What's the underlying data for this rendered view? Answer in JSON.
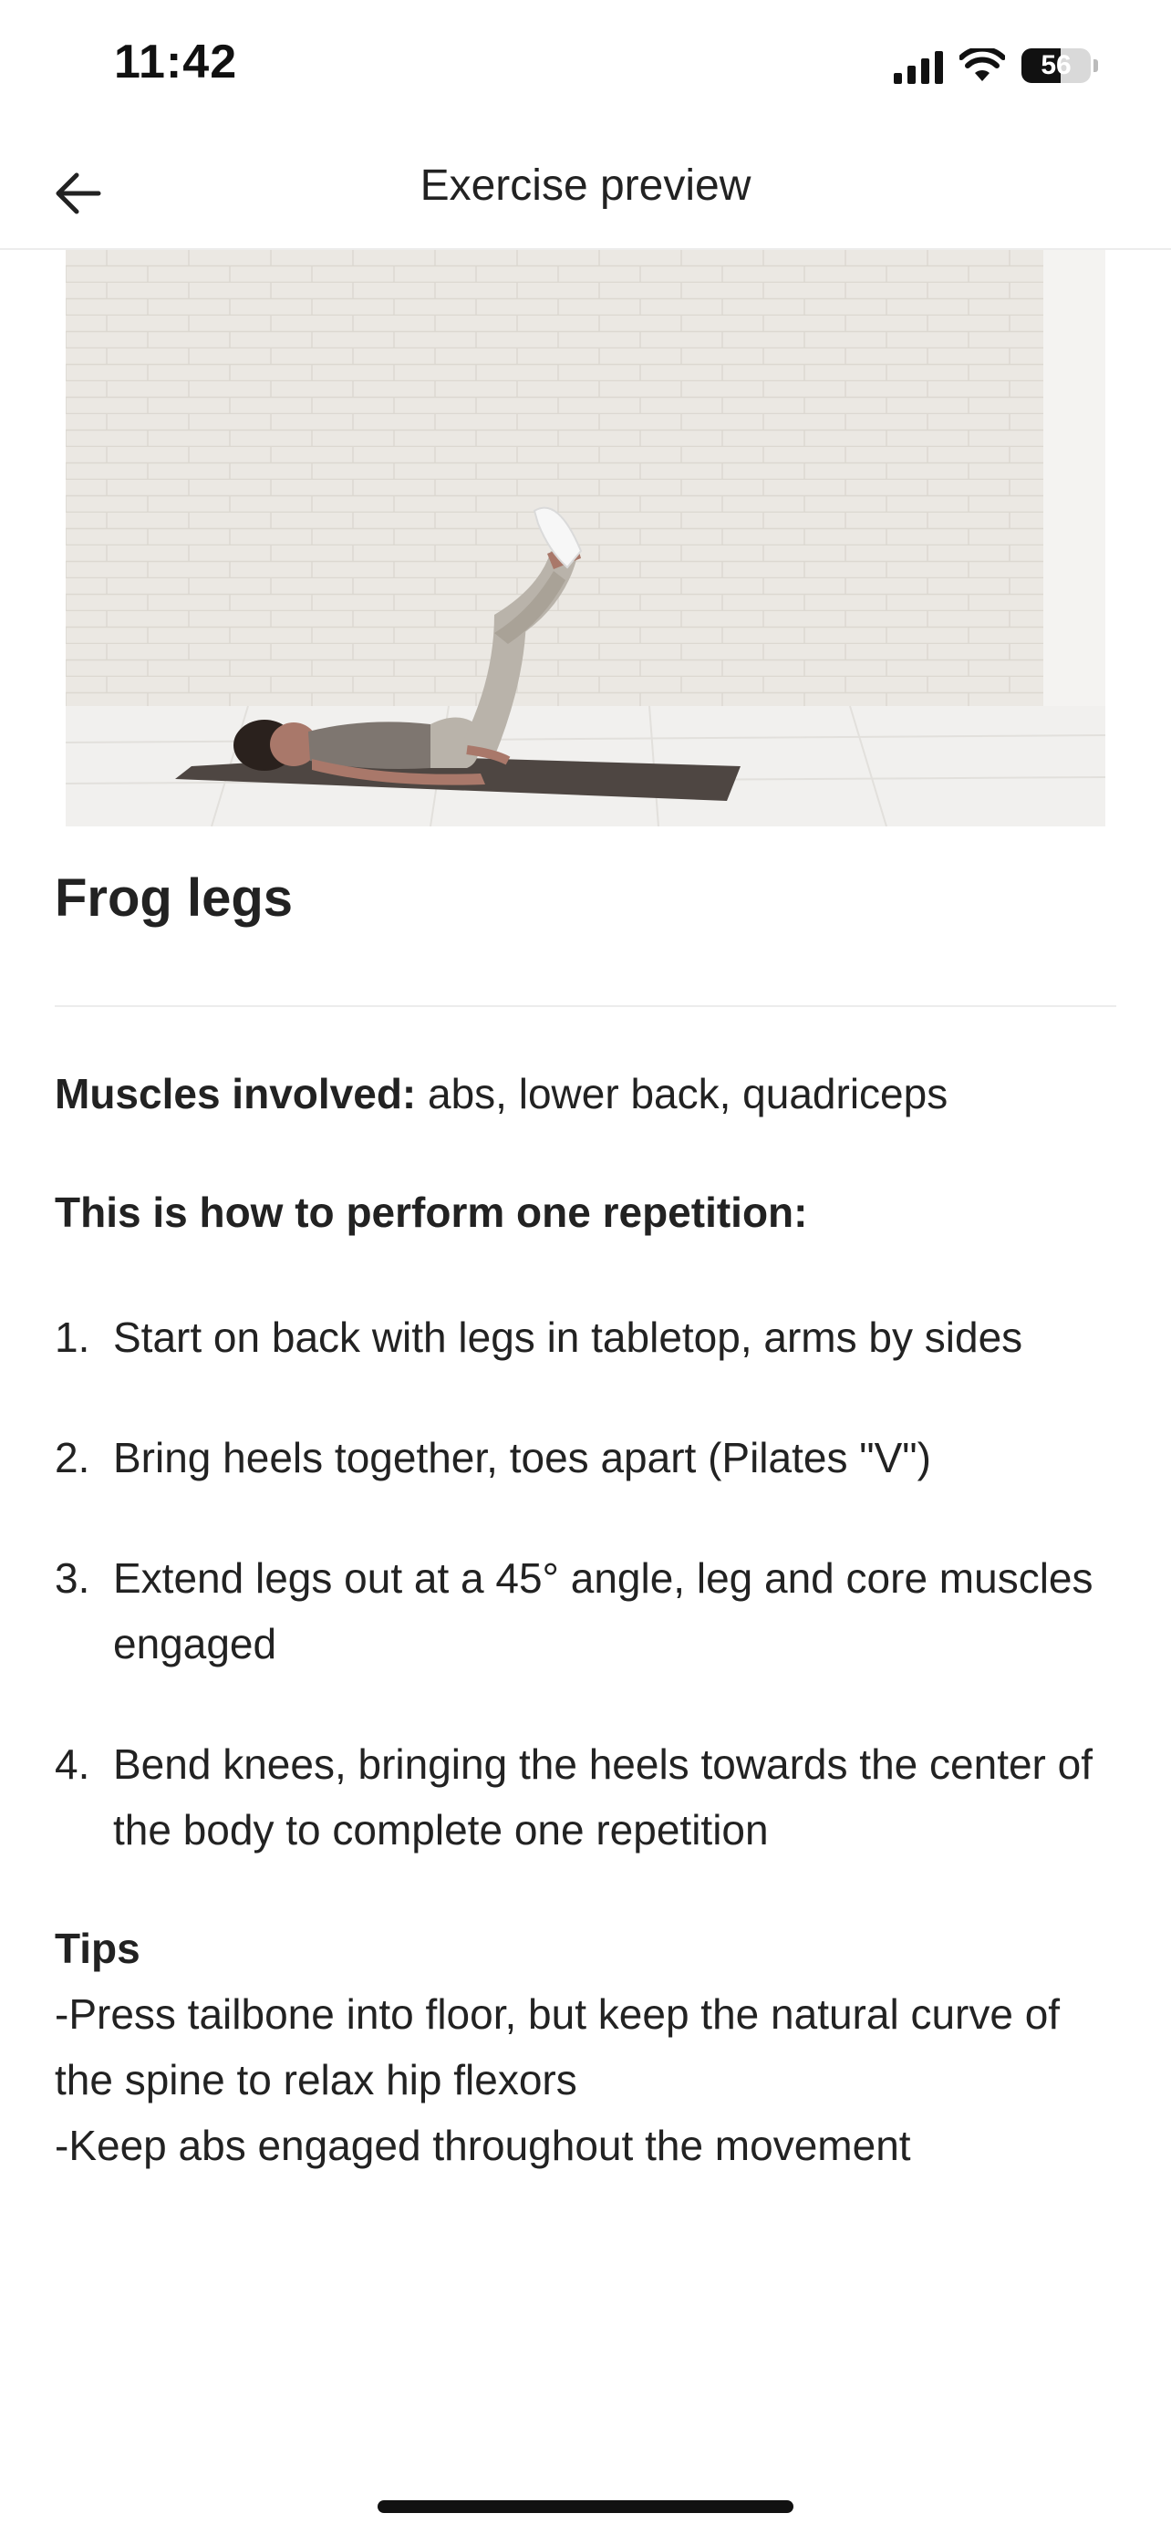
{
  "status_bar": {
    "time": "11:42",
    "battery_level": "56",
    "icons": [
      "cellular-signal-icon",
      "wifi-icon",
      "battery-icon"
    ]
  },
  "header": {
    "title": "Exercise preview",
    "back_icon": "arrow-left-icon"
  },
  "exercise": {
    "title": "Frog legs",
    "muscles_label": "Muscles involved:",
    "muscles_value": " abs, lower back, quadriceps",
    "howto_heading": "This is how to perform one repetition:",
    "steps": [
      {
        "num": "1.",
        "text": "Start on back with legs in tabletop, arms by sides"
      },
      {
        "num": "2.",
        "text": "Bring heels together, toes apart (Pilates \"V\")"
      },
      {
        "num": "3.",
        "text": "Extend legs out at a 45° angle, leg and core muscles engaged"
      },
      {
        "num": "4.",
        "text": "Bend knees, bringing the heels towards the center of the body to complete one repetition"
      }
    ],
    "tips_heading": "Tips",
    "tips": [
      "-Press tailbone into floor, but keep the natural curve of the spine to relax hip flexors",
      "-Keep abs engaged throughout the movement"
    ]
  }
}
